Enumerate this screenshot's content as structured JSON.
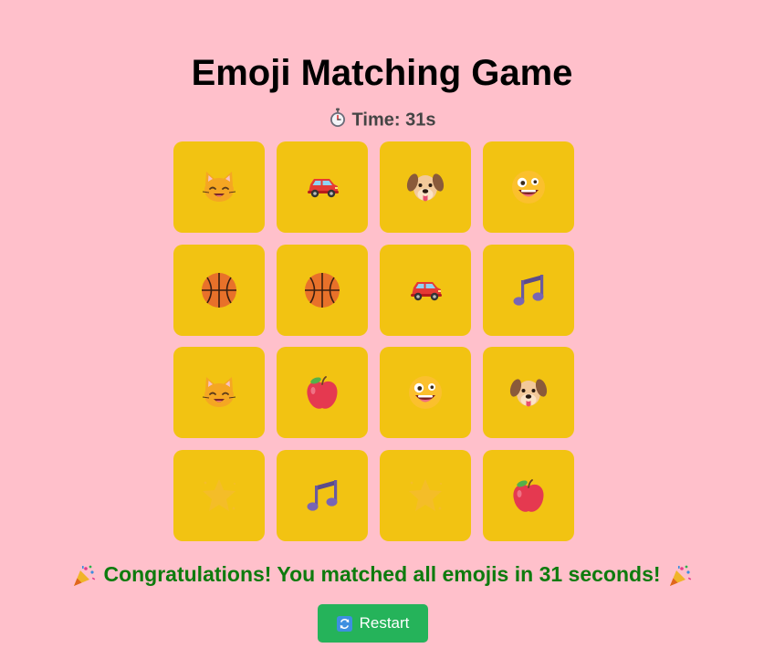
{
  "game": {
    "title": "Emoji Matching Game",
    "timer_label": "Time: 31s",
    "congrats": "Congratulations! You matched all emojis in 31 seconds!",
    "restart_label": "Restart"
  },
  "cards": [
    {
      "emoji": "cat-face",
      "faded": false
    },
    {
      "emoji": "car",
      "faded": false
    },
    {
      "emoji": "dog-face",
      "faded": false
    },
    {
      "emoji": "zany-face",
      "faded": false
    },
    {
      "emoji": "basketball",
      "faded": false
    },
    {
      "emoji": "basketball",
      "faded": false
    },
    {
      "emoji": "car",
      "faded": false
    },
    {
      "emoji": "music-note",
      "faded": false
    },
    {
      "emoji": "cat-face",
      "faded": false
    },
    {
      "emoji": "apple",
      "faded": false
    },
    {
      "emoji": "zany-face",
      "faded": false
    },
    {
      "emoji": "dog-face",
      "faded": false
    },
    {
      "emoji": "star",
      "faded": true
    },
    {
      "emoji": "music-note",
      "faded": false
    },
    {
      "emoji": "star",
      "faded": true
    },
    {
      "emoji": "apple",
      "faded": false
    }
  ],
  "colors": {
    "background": "#ffc0cb",
    "card": "#f2c312",
    "message": "#0e7b0e",
    "button": "#25b35a"
  }
}
